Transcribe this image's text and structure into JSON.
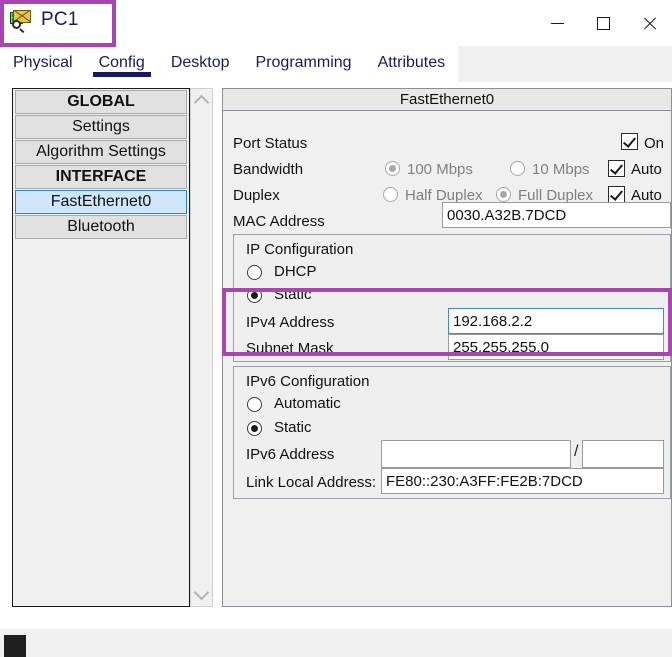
{
  "window": {
    "title": "PC1",
    "icon": "packet-tracer-pc-icon",
    "minimize_label": "—",
    "maximize_label": "☐",
    "close_label": "✕"
  },
  "tabs": [
    {
      "label": "Physical",
      "active": false
    },
    {
      "label": "Config",
      "active": true
    },
    {
      "label": "Desktop",
      "active": false
    },
    {
      "label": "Programming",
      "active": false
    },
    {
      "label": "Attributes",
      "active": false
    }
  ],
  "sidebar": {
    "items": [
      {
        "label": "GLOBAL",
        "type": "header",
        "selected": false
      },
      {
        "label": "Settings",
        "type": "item",
        "selected": false
      },
      {
        "label": "Algorithm Settings",
        "type": "item",
        "selected": false
      },
      {
        "label": "INTERFACE",
        "type": "header",
        "selected": false
      },
      {
        "label": "FastEthernet0",
        "type": "item",
        "selected": true
      },
      {
        "label": "Bluetooth",
        "type": "item",
        "selected": false
      }
    ],
    "scroll_up": "chevron-up-icon",
    "scroll_down": "chevron-down-icon"
  },
  "panel": {
    "title": "FastEthernet0",
    "port_status": {
      "label": "Port Status",
      "checkbox_label": "On",
      "checked": true
    },
    "bandwidth": {
      "label": "Bandwidth",
      "option_100": "100 Mbps",
      "option_10": "10 Mbps",
      "selected": "100 Mbps",
      "auto_label": "Auto",
      "auto_checked": true,
      "disabled": true
    },
    "duplex": {
      "label": "Duplex",
      "option_half": "Half Duplex",
      "option_full": "Full Duplex",
      "selected": "Full Duplex",
      "auto_label": "Auto",
      "auto_checked": true,
      "disabled": true
    },
    "mac": {
      "label": "MAC Address",
      "value": "0030.A32B.7DCD"
    },
    "ip_configuration": {
      "legend": "IP Configuration",
      "dhcp_label": "DHCP",
      "static_label": "Static",
      "selected": "Static",
      "ipv4_label": "IPv4 Address",
      "ipv4_value": "192.168.2.2",
      "subnet_label": "Subnet Mask",
      "subnet_value": "255.255.255.0"
    },
    "ipv6_configuration": {
      "legend": "IPv6 Configuration",
      "automatic_label": "Automatic",
      "static_label": "Static",
      "selected": "Static",
      "ipv6_label": "IPv6 Address",
      "ipv6_value": "",
      "ipv6_prefix_value": "",
      "separator": "/",
      "link_local_label": "Link Local Address:",
      "link_local_value": "FE80::230:A3FF:FE2B:7DCD"
    }
  },
  "annotations": {
    "highlight_color": "#a845b0",
    "highlight_title": "pc1-title-highlight",
    "highlight_ip": "ipv4-subnet-highlight"
  }
}
